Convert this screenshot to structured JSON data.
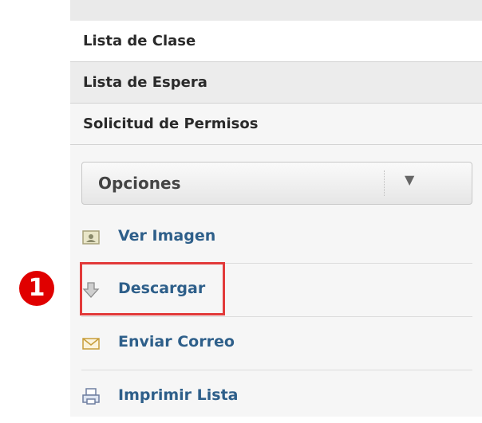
{
  "tabs": [
    {
      "label": "Lista de Clase"
    },
    {
      "label": "Lista de Espera"
    },
    {
      "label": "Solicitud de Permisos"
    }
  ],
  "options": {
    "label": "Opciones"
  },
  "actions": [
    {
      "label": "Ver Imagen",
      "icon": "image-icon"
    },
    {
      "label": "Descargar",
      "icon": "download-icon"
    },
    {
      "label": "Enviar Correo",
      "icon": "mail-icon"
    },
    {
      "label": "Imprimir Lista",
      "icon": "print-icon"
    }
  ],
  "annotation": {
    "step": "1",
    "color": "#e00000"
  }
}
